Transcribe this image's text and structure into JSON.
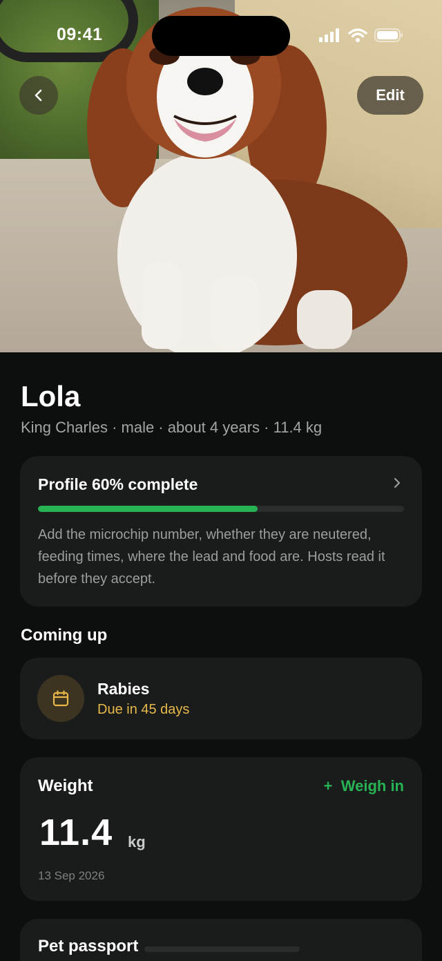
{
  "status_bar": {
    "time": "09:41"
  },
  "header": {
    "edit_label": "Edit"
  },
  "pet": {
    "name": "Lola",
    "meta": "King Charles · male · about 4 years · 11.4 kg"
  },
  "profile_card": {
    "title": "Profile 60% complete",
    "progress_percent": 60,
    "description": "Add the microchip number, whether they are neutered, feeding times, where the lead and food are. Hosts read it before they accept."
  },
  "coming_up": {
    "title": "Coming up",
    "items": [
      {
        "title": "Rabies",
        "subtitle": "Due in 45 days",
        "icon": "calendar-icon"
      }
    ]
  },
  "weight_card": {
    "title": "Weight",
    "action_label": "Weigh in",
    "action_icon": "plus-icon",
    "value": "11.4",
    "unit": "kg",
    "date": "13 Sep 2026"
  },
  "passport_card": {
    "title": "Pet passport"
  },
  "colors": {
    "accent_green": "#27b354",
    "due_amber": "#e8b94a",
    "card_bg": "#1a1c1c",
    "page_bg": "#0d0e0e"
  }
}
